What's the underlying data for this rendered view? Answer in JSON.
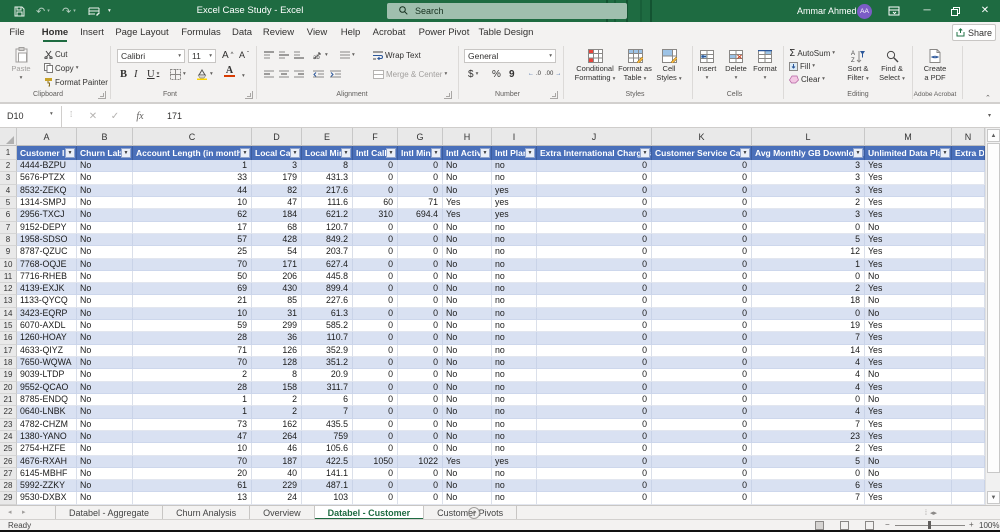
{
  "title_bar": {
    "title": "Excel Case Study - Excel",
    "search_placeholder": "Search",
    "user_name": "Ammar Ahmed",
    "user_initials": "AA"
  },
  "ribbon_tabs": [
    {
      "label": "File",
      "active": false
    },
    {
      "label": "Home",
      "active": true
    },
    {
      "label": "Insert",
      "active": false
    },
    {
      "label": "Page Layout",
      "active": false
    },
    {
      "label": "Formulas",
      "active": false
    },
    {
      "label": "Data",
      "active": false
    },
    {
      "label": "Review",
      "active": false
    },
    {
      "label": "View",
      "active": false
    },
    {
      "label": "Help",
      "active": false
    },
    {
      "label": "Acrobat",
      "active": false
    },
    {
      "label": "Power Pivot",
      "active": false
    },
    {
      "label": "Table Design",
      "active": false
    }
  ],
  "share_label": "Share",
  "ribbon": {
    "clipboard": {
      "label": "Clipboard",
      "paste": "Paste",
      "cut": "Cut",
      "copy": "Copy",
      "format_painter": "Format Painter"
    },
    "font": {
      "label": "Font",
      "font_name": "Calibri",
      "font_size": "11"
    },
    "alignment": {
      "label": "Alignment",
      "wrap_text": "Wrap Text",
      "merge_center": "Merge & Center"
    },
    "number": {
      "label": "Number",
      "format": "General"
    },
    "styles": {
      "label": "Styles",
      "conditional_1": "Conditional",
      "conditional_2": "Formatting",
      "format_table_1": "Format as",
      "format_table_2": "Table",
      "cell_styles_1": "Cell",
      "cell_styles_2": "Styles"
    },
    "cells": {
      "label": "Cells",
      "insert": "Insert",
      "delete": "Delete",
      "format": "Format"
    },
    "editing": {
      "label": "Editing",
      "autosum": "AutoSum",
      "fill": "Fill",
      "clear": "Clear",
      "sort_1": "Sort &",
      "sort_2": "Filter",
      "find_1": "Find &",
      "find_2": "Select"
    },
    "acrobat": {
      "label": "Adobe Acrobat",
      "create_pdf_1": "Create",
      "create_pdf_2": "a PDF"
    }
  },
  "formula_bar": {
    "name_box": "D10",
    "value": "171"
  },
  "sheet": {
    "columns": [
      "A",
      "B",
      "C",
      "D",
      "E",
      "F",
      "G",
      "H",
      "I",
      "J",
      "K",
      "L",
      "M",
      "N"
    ],
    "table_headers": [
      "Customer ID",
      "Churn Label",
      "Account Length (in months)",
      "Local Calls",
      "Local Mins",
      "Intl Calls",
      "Intl Mins",
      "Intl Active",
      "Intl Plan",
      "Extra International Charges",
      "Customer Service Calls",
      "Avg Monthly GB Download",
      "Unlimited Data Plan",
      "Extra Da"
    ],
    "rows": [
      [
        "4444-BZPU",
        "No",
        "1",
        "3",
        "8",
        "0",
        "0",
        "No",
        "no",
        "0",
        "0",
        "3",
        "Yes",
        ""
      ],
      [
        "5676-PTZX",
        "No",
        "33",
        "179",
        "431.3",
        "0",
        "0",
        "No",
        "no",
        "0",
        "0",
        "3",
        "Yes",
        ""
      ],
      [
        "8532-ZEKQ",
        "No",
        "44",
        "82",
        "217.6",
        "0",
        "0",
        "No",
        "yes",
        "0",
        "0",
        "3",
        "Yes",
        ""
      ],
      [
        "1314-SMPJ",
        "No",
        "10",
        "47",
        "111.6",
        "60",
        "71",
        "Yes",
        "yes",
        "0",
        "0",
        "2",
        "Yes",
        ""
      ],
      [
        "2956-TXCJ",
        "No",
        "62",
        "184",
        "621.2",
        "310",
        "694.4",
        "Yes",
        "yes",
        "0",
        "0",
        "3",
        "Yes",
        ""
      ],
      [
        "9152-DEPY",
        "No",
        "17",
        "68",
        "120.7",
        "0",
        "0",
        "No",
        "no",
        "0",
        "0",
        "0",
        "No",
        ""
      ],
      [
        "1958-SDSO",
        "No",
        "57",
        "428",
        "849.2",
        "0",
        "0",
        "No",
        "no",
        "0",
        "0",
        "5",
        "Yes",
        ""
      ],
      [
        "8787-QZUC",
        "No",
        "25",
        "54",
        "203.7",
        "0",
        "0",
        "No",
        "no",
        "0",
        "0",
        "12",
        "Yes",
        ""
      ],
      [
        "7768-OQJE",
        "No",
        "70",
        "171",
        "627.4",
        "0",
        "0",
        "No",
        "no",
        "0",
        "0",
        "1",
        "Yes",
        ""
      ],
      [
        "7716-RHEB",
        "No",
        "50",
        "206",
        "445.8",
        "0",
        "0",
        "No",
        "no",
        "0",
        "0",
        "0",
        "No",
        ""
      ],
      [
        "4139-EXJK",
        "No",
        "69",
        "430",
        "899.4",
        "0",
        "0",
        "No",
        "no",
        "0",
        "0",
        "2",
        "Yes",
        ""
      ],
      [
        "1133-QYCQ",
        "No",
        "21",
        "85",
        "227.6",
        "0",
        "0",
        "No",
        "no",
        "0",
        "0",
        "18",
        "No",
        ""
      ],
      [
        "3423-EQRP",
        "No",
        "10",
        "31",
        "61.3",
        "0",
        "0",
        "No",
        "no",
        "0",
        "0",
        "0",
        "No",
        ""
      ],
      [
        "6070-AXDL",
        "No",
        "59",
        "299",
        "585.2",
        "0",
        "0",
        "No",
        "no",
        "0",
        "0",
        "19",
        "Yes",
        ""
      ],
      [
        "1260-HOAY",
        "No",
        "28",
        "36",
        "110.7",
        "0",
        "0",
        "No",
        "no",
        "0",
        "0",
        "7",
        "Yes",
        ""
      ],
      [
        "4633-QIYZ",
        "No",
        "71",
        "126",
        "352.9",
        "0",
        "0",
        "No",
        "no",
        "0",
        "0",
        "14",
        "Yes",
        ""
      ],
      [
        "7650-WQWA",
        "No",
        "70",
        "128",
        "351.2",
        "0",
        "0",
        "No",
        "no",
        "0",
        "0",
        "4",
        "Yes",
        ""
      ],
      [
        "9039-LTDP",
        "No",
        "2",
        "8",
        "20.9",
        "0",
        "0",
        "No",
        "no",
        "0",
        "0",
        "4",
        "No",
        ""
      ],
      [
        "9552-QCAO",
        "No",
        "28",
        "158",
        "311.7",
        "0",
        "0",
        "No",
        "no",
        "0",
        "0",
        "4",
        "Yes",
        ""
      ],
      [
        "8785-ENDQ",
        "No",
        "1",
        "2",
        "6",
        "0",
        "0",
        "No",
        "no",
        "0",
        "0",
        "0",
        "No",
        ""
      ],
      [
        "0640-LNBK",
        "No",
        "1",
        "2",
        "7",
        "0",
        "0",
        "No",
        "no",
        "0",
        "0",
        "4",
        "Yes",
        ""
      ],
      [
        "4782-CHZM",
        "No",
        "73",
        "162",
        "435.5",
        "0",
        "0",
        "No",
        "no",
        "0",
        "0",
        "7",
        "Yes",
        ""
      ],
      [
        "1380-YANO",
        "No",
        "47",
        "264",
        "759",
        "0",
        "0",
        "No",
        "no",
        "0",
        "0",
        "23",
        "Yes",
        ""
      ],
      [
        "2754-HZFE",
        "No",
        "10",
        "46",
        "105.6",
        "0",
        "0",
        "No",
        "no",
        "0",
        "0",
        "2",
        "Yes",
        ""
      ],
      [
        "4676-RXAH",
        "No",
        "70",
        "187",
        "422.5",
        "1050",
        "1022",
        "Yes",
        "yes",
        "0",
        "0",
        "5",
        "No",
        ""
      ],
      [
        "6145-MBHF",
        "No",
        "20",
        "40",
        "141.1",
        "0",
        "0",
        "No",
        "no",
        "0",
        "0",
        "0",
        "No",
        ""
      ],
      [
        "5992-ZZKY",
        "No",
        "61",
        "229",
        "487.1",
        "0",
        "0",
        "No",
        "no",
        "0",
        "0",
        "6",
        "Yes",
        ""
      ],
      [
        "9530-DXBX",
        "No",
        "13",
        "24",
        "103",
        "0",
        "0",
        "No",
        "no",
        "0",
        "0",
        "7",
        "Yes",
        ""
      ]
    ]
  },
  "sheet_tabs": [
    {
      "label": "Databel - Aggregate",
      "active": false
    },
    {
      "label": "Churn Analysis",
      "active": false
    },
    {
      "label": "Overview",
      "active": false
    },
    {
      "label": "Databel - Customer",
      "active": true
    },
    {
      "label": "Customer Pivots",
      "active": false
    }
  ],
  "status_bar": {
    "mode": "Ready",
    "zoom": "100%"
  }
}
